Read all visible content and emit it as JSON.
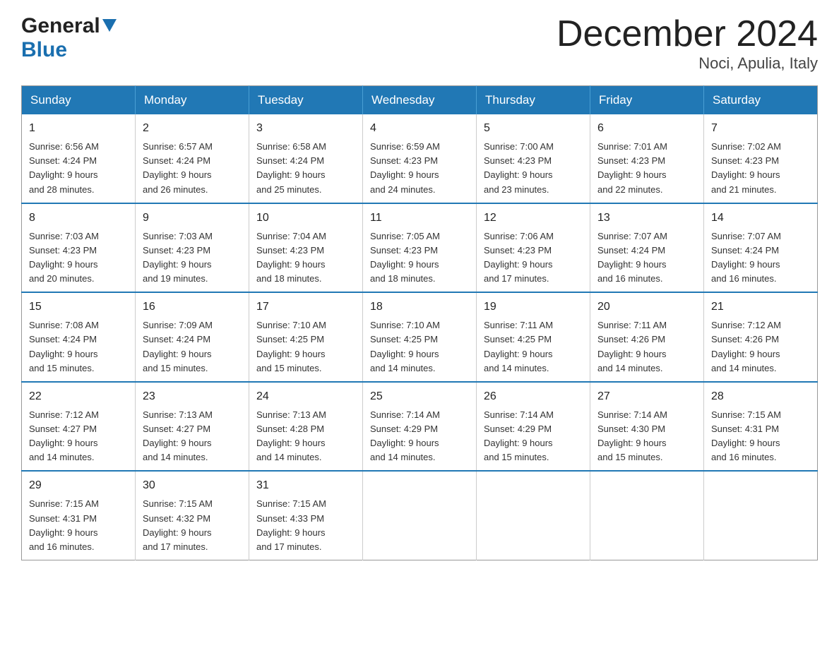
{
  "logo": {
    "general": "General",
    "blue": "Blue"
  },
  "title": {
    "month_year": "December 2024",
    "location": "Noci, Apulia, Italy"
  },
  "days_of_week": [
    "Sunday",
    "Monday",
    "Tuesday",
    "Wednesday",
    "Thursday",
    "Friday",
    "Saturday"
  ],
  "weeks": [
    [
      {
        "day": "1",
        "sunrise": "6:56 AM",
        "sunset": "4:24 PM",
        "daylight": "9 hours and 28 minutes."
      },
      {
        "day": "2",
        "sunrise": "6:57 AM",
        "sunset": "4:24 PM",
        "daylight": "9 hours and 26 minutes."
      },
      {
        "day": "3",
        "sunrise": "6:58 AM",
        "sunset": "4:24 PM",
        "daylight": "9 hours and 25 minutes."
      },
      {
        "day": "4",
        "sunrise": "6:59 AM",
        "sunset": "4:23 PM",
        "daylight": "9 hours and 24 minutes."
      },
      {
        "day": "5",
        "sunrise": "7:00 AM",
        "sunset": "4:23 PM",
        "daylight": "9 hours and 23 minutes."
      },
      {
        "day": "6",
        "sunrise": "7:01 AM",
        "sunset": "4:23 PM",
        "daylight": "9 hours and 22 minutes."
      },
      {
        "day": "7",
        "sunrise": "7:02 AM",
        "sunset": "4:23 PM",
        "daylight": "9 hours and 21 minutes."
      }
    ],
    [
      {
        "day": "8",
        "sunrise": "7:03 AM",
        "sunset": "4:23 PM",
        "daylight": "9 hours and 20 minutes."
      },
      {
        "day": "9",
        "sunrise": "7:03 AM",
        "sunset": "4:23 PM",
        "daylight": "9 hours and 19 minutes."
      },
      {
        "day": "10",
        "sunrise": "7:04 AM",
        "sunset": "4:23 PM",
        "daylight": "9 hours and 18 minutes."
      },
      {
        "day": "11",
        "sunrise": "7:05 AM",
        "sunset": "4:23 PM",
        "daylight": "9 hours and 18 minutes."
      },
      {
        "day": "12",
        "sunrise": "7:06 AM",
        "sunset": "4:23 PM",
        "daylight": "9 hours and 17 minutes."
      },
      {
        "day": "13",
        "sunrise": "7:07 AM",
        "sunset": "4:24 PM",
        "daylight": "9 hours and 16 minutes."
      },
      {
        "day": "14",
        "sunrise": "7:07 AM",
        "sunset": "4:24 PM",
        "daylight": "9 hours and 16 minutes."
      }
    ],
    [
      {
        "day": "15",
        "sunrise": "7:08 AM",
        "sunset": "4:24 PM",
        "daylight": "9 hours and 15 minutes."
      },
      {
        "day": "16",
        "sunrise": "7:09 AM",
        "sunset": "4:24 PM",
        "daylight": "9 hours and 15 minutes."
      },
      {
        "day": "17",
        "sunrise": "7:10 AM",
        "sunset": "4:25 PM",
        "daylight": "9 hours and 15 minutes."
      },
      {
        "day": "18",
        "sunrise": "7:10 AM",
        "sunset": "4:25 PM",
        "daylight": "9 hours and 14 minutes."
      },
      {
        "day": "19",
        "sunrise": "7:11 AM",
        "sunset": "4:25 PM",
        "daylight": "9 hours and 14 minutes."
      },
      {
        "day": "20",
        "sunrise": "7:11 AM",
        "sunset": "4:26 PM",
        "daylight": "9 hours and 14 minutes."
      },
      {
        "day": "21",
        "sunrise": "7:12 AM",
        "sunset": "4:26 PM",
        "daylight": "9 hours and 14 minutes."
      }
    ],
    [
      {
        "day": "22",
        "sunrise": "7:12 AM",
        "sunset": "4:27 PM",
        "daylight": "9 hours and 14 minutes."
      },
      {
        "day": "23",
        "sunrise": "7:13 AM",
        "sunset": "4:27 PM",
        "daylight": "9 hours and 14 minutes."
      },
      {
        "day": "24",
        "sunrise": "7:13 AM",
        "sunset": "4:28 PM",
        "daylight": "9 hours and 14 minutes."
      },
      {
        "day": "25",
        "sunrise": "7:14 AM",
        "sunset": "4:29 PM",
        "daylight": "9 hours and 14 minutes."
      },
      {
        "day": "26",
        "sunrise": "7:14 AM",
        "sunset": "4:29 PM",
        "daylight": "9 hours and 15 minutes."
      },
      {
        "day": "27",
        "sunrise": "7:14 AM",
        "sunset": "4:30 PM",
        "daylight": "9 hours and 15 minutes."
      },
      {
        "day": "28",
        "sunrise": "7:15 AM",
        "sunset": "4:31 PM",
        "daylight": "9 hours and 16 minutes."
      }
    ],
    [
      {
        "day": "29",
        "sunrise": "7:15 AM",
        "sunset": "4:31 PM",
        "daylight": "9 hours and 16 minutes."
      },
      {
        "day": "30",
        "sunrise": "7:15 AM",
        "sunset": "4:32 PM",
        "daylight": "9 hours and 17 minutes."
      },
      {
        "day": "31",
        "sunrise": "7:15 AM",
        "sunset": "4:33 PM",
        "daylight": "9 hours and 17 minutes."
      },
      null,
      null,
      null,
      null
    ]
  ],
  "labels": {
    "sunrise": "Sunrise:",
    "sunset": "Sunset:",
    "daylight": "Daylight:"
  }
}
